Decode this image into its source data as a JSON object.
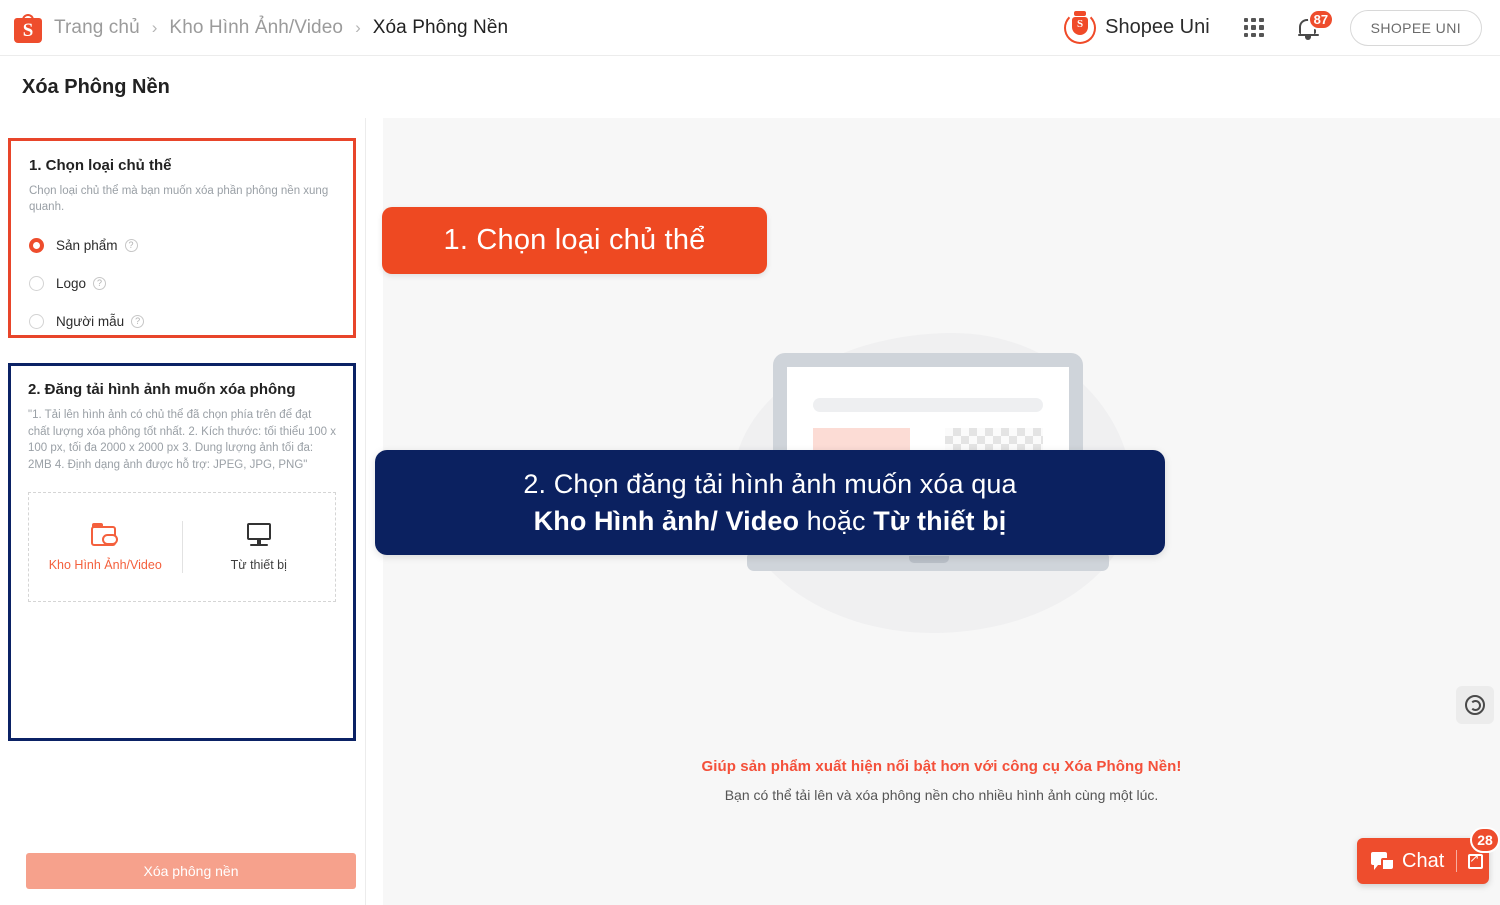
{
  "header": {
    "logo_letter": "S",
    "breadcrumbs": [
      {
        "label": "Trang chủ",
        "active": false
      },
      {
        "label": "Kho Hình Ảnh/Video",
        "active": false
      },
      {
        "label": "Xóa Phông Nền",
        "active": true
      }
    ],
    "separator": "›",
    "uni_label": "Shopee Uni",
    "uni_shield_letter": "S",
    "notification_count": "87",
    "account_button": "SHOPEE UNI"
  },
  "page": {
    "title": "Xóa Phông Nền"
  },
  "section1": {
    "heading": "1. Chọn loại chủ thể",
    "description": "Chọn loại chủ thể mà bạn muốn xóa phần phông nền xung quanh.",
    "options": [
      {
        "label": "Sản phẩm",
        "selected": true
      },
      {
        "label": "Logo",
        "selected": false
      },
      {
        "label": "Người mẫu",
        "selected": false
      }
    ],
    "help_glyph": "?"
  },
  "section2": {
    "heading": "2. Đăng tải hình ảnh muốn xóa phông",
    "description": "\"1. Tải lên hình ảnh có chủ thể đã chọn phía trên để đạt chất lượng xóa phông tốt nhất. 2. Kích thước: tối thiểu 100 x 100 px, tối đa 2000 x 2000 px 3. Dung lượng ảnh tối đa: 2MB 4. Định dạng ảnh được hỗ trợ: JPEG, JPG, PNG\"",
    "upload_from_library": "Kho Hình Ảnh/Video",
    "upload_from_device": "Từ thiết bị"
  },
  "submit": {
    "label": "Xóa phông nền"
  },
  "callouts": {
    "step1": "1. Chọn loại chủ thể",
    "step2_line1": "2. Chọn đăng tải hình ảnh muốn xóa qua",
    "step2_line2_a": "Kho Hình ảnh/ Video",
    "step2_line2_b": " hoặc ",
    "step2_line2_c": "Từ thiết bị"
  },
  "illustration": {
    "tagline_primary": "Giúp sản phẩm xuất hiện nổi bật hơn với công cụ Xóa Phông Nền!",
    "tagline_secondary": "Bạn có thể tải lên và xóa phông nền cho nhiều hình ảnh cùng một lúc."
  },
  "chat": {
    "label": "Chat",
    "count": "28"
  },
  "colors": {
    "shopee_orange": "#ee4d2d",
    "callout_orange": "#ee4922",
    "callout_navy": "#0b2160",
    "card1_border": "#e8452a",
    "card2_border": "#0b2265",
    "submit_disabled": "#f6a18c",
    "tagline_red": "#f4503a"
  }
}
